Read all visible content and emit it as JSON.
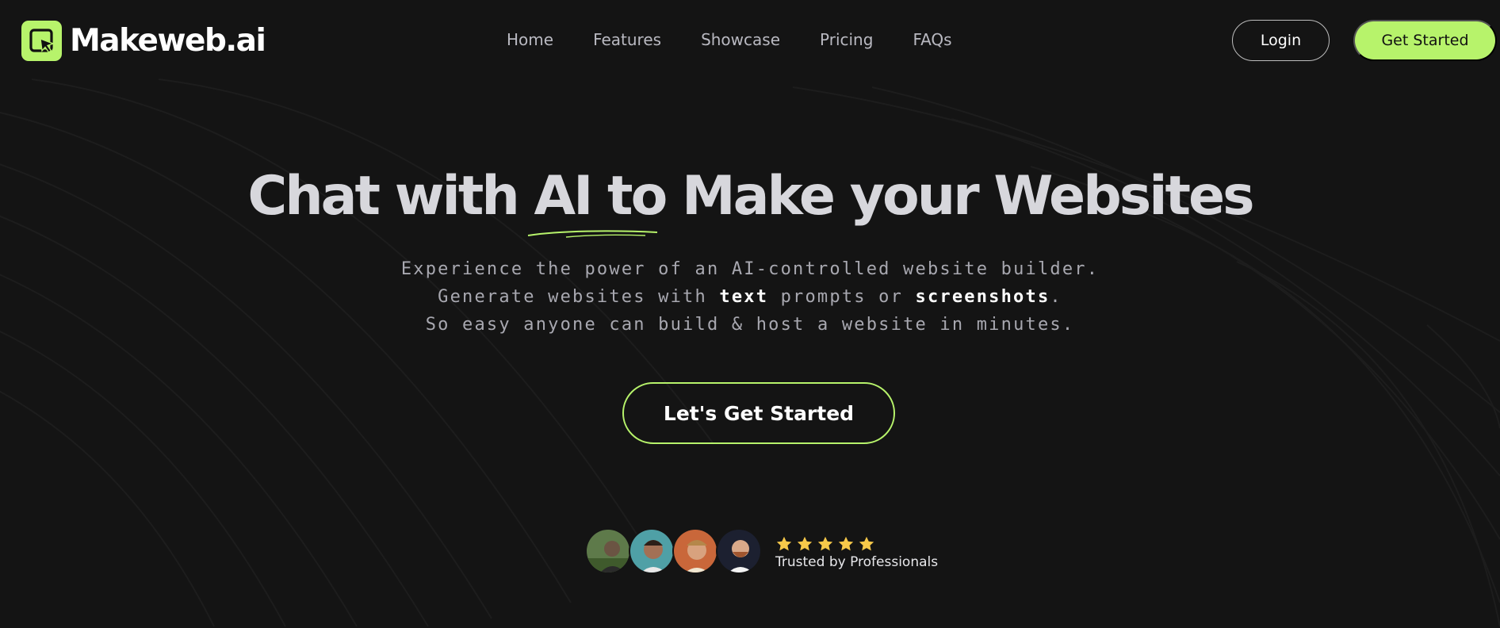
{
  "brand": {
    "name": "Makeweb.ai",
    "accent_color": "#b7f36b",
    "logo_icon": "cursor-click-icon"
  },
  "nav": {
    "links": [
      "Home",
      "Features",
      "Showcase",
      "Pricing",
      "FAQs"
    ],
    "login_label": "Login",
    "get_started_label": "Get Started"
  },
  "hero": {
    "title": "Chat with AI to Make your Websites",
    "subtitle": {
      "line1": "Experience the power of an AI-controlled website builder.",
      "line2_before": "Generate websites with ",
      "line2_bold1": "text",
      "line2_mid": " prompts or ",
      "line2_bold2": "screenshots",
      "line2_after": ".",
      "line3": "So easy anyone can build & host a website in minutes."
    },
    "cta_label": "Let's Get Started"
  },
  "social_proof": {
    "rating_stars": 5,
    "star_color": "#f7c94a",
    "trusted_text": "Trusted by Professionals"
  }
}
